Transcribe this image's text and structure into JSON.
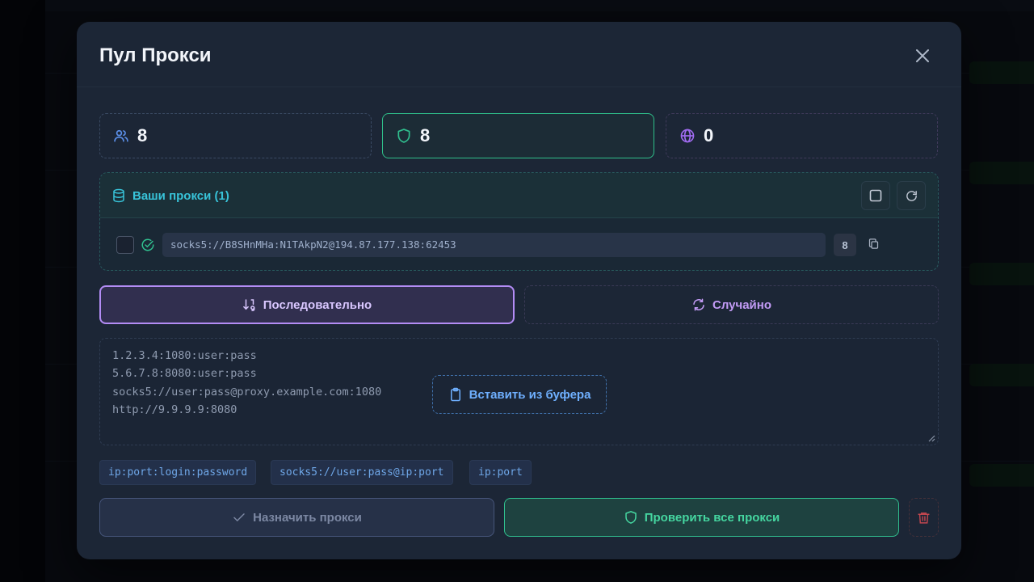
{
  "modal": {
    "title": "Пул Прокси"
  },
  "stats": [
    {
      "value": "8",
      "icon": "users-icon"
    },
    {
      "value": "8",
      "icon": "shield-icon"
    },
    {
      "value": "0",
      "icon": "globe-icon"
    }
  ],
  "your_proxies": {
    "title": "Ваши прокси (1)",
    "items": [
      {
        "url": "socks5://B8SHnMHa:N1TAkpN2@194.87.177.138:62453",
        "count": "8",
        "status": "ok"
      }
    ]
  },
  "mode": {
    "sequential_label": "Последовательно",
    "random_label": "Случайно",
    "selected": "sequential"
  },
  "input": {
    "placeholder_lines": [
      "1.2.3.4:1080:user:pass",
      "5.6.7.8:8080:user:pass",
      "socks5://user:pass@proxy.example.com:1080",
      "http://9.9.9.9:8080"
    ],
    "paste_label": "Вставить из буфера"
  },
  "formats": [
    "ip:port:login:password",
    "socks5://user:pass@ip:port",
    "ip:port"
  ],
  "actions": {
    "assign_label": "Назначить прокси",
    "check_all_label": "Проверить все прокси"
  },
  "colors": {
    "accent_green": "#30c08f",
    "accent_purple": "#b38cf5",
    "accent_cyan": "#38c3d9",
    "accent_blue": "#6fb0ff",
    "danger": "#c2464f"
  }
}
